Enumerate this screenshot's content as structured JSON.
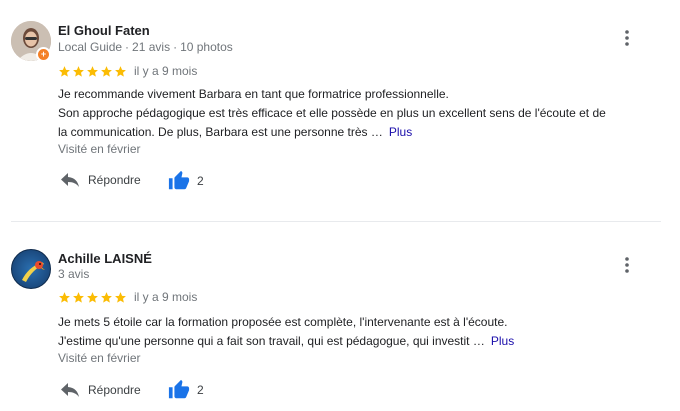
{
  "reviews": [
    {
      "author": "El Ghoul Faten",
      "badge": "Local Guide",
      "review_count": "21 avis",
      "photo_count": "10 photos",
      "rating": 5,
      "date": "il y a 9 mois",
      "text_lines": [
        "Je recommande vivement Barbara en tant que formatrice professionnelle.",
        "Son approche pédagogique est très efficace et elle possède en plus un excellent sens de l'écoute et de",
        "la communication. De plus, Barbara est une personne très …"
      ],
      "more_label": "Plus",
      "visited": "Visité en février",
      "reply_label": "Répondre",
      "likes": "2"
    },
    {
      "author": "Achille LAISNÉ",
      "review_count": "3 avis",
      "rating": 5,
      "date": "il y a 9 mois",
      "text_lines": [
        "Je mets 5 étoile car la formation proposée est complète, l'intervenante est à l'écoute.",
        "J'estime qu'une personne qui a fait son travail, qui est pédagogue, qui investit …"
      ],
      "more_label": "Plus",
      "visited": "Visité en février",
      "reply_label": "Répondre",
      "likes": "2"
    }
  ],
  "colors": {
    "star": "#fbbc04",
    "like": "#1a73e8",
    "link": "#1a0dab",
    "muted": "#70757a",
    "badge": "#f48026"
  },
  "icons": {
    "more": "more-vert-icon",
    "reply": "reply-arrow-icon",
    "like": "thumbs-up-icon",
    "star": "star-icon"
  }
}
